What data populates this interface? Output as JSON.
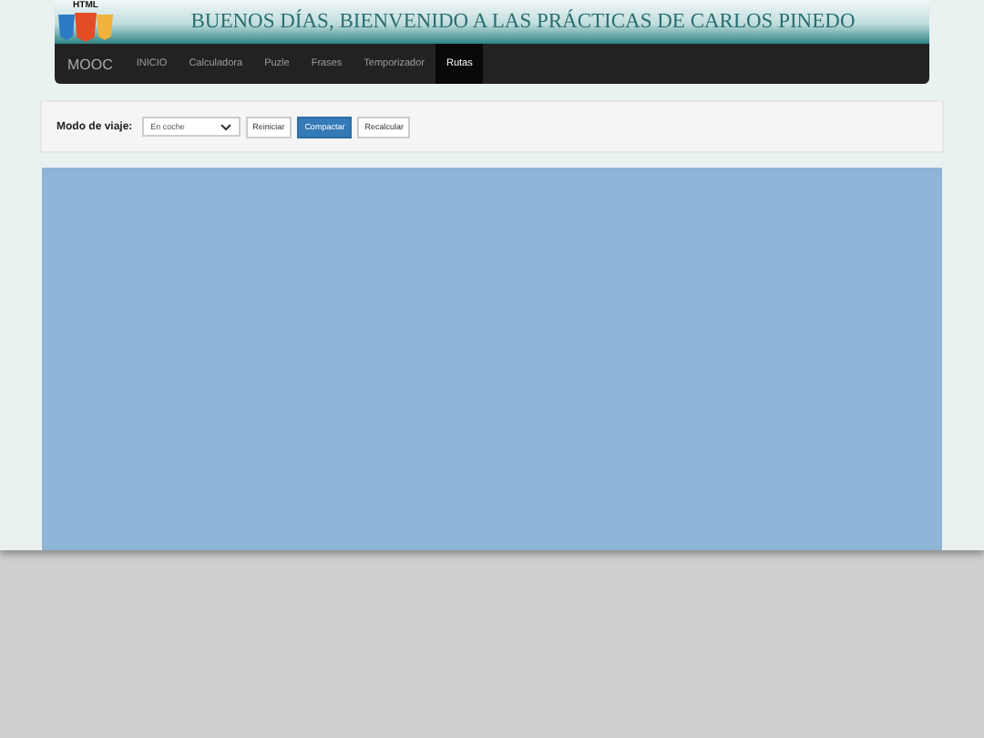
{
  "header": {
    "logo_text": "HTML",
    "title": "BUENOS DÍAS, BIENVENIDO A LAS PRÁCTICAS DE CARLOS PINEDO"
  },
  "navbar": {
    "brand": "MOOC",
    "items": [
      {
        "label": "INICIO",
        "selected": false
      },
      {
        "label": "Calculadora",
        "selected": false
      },
      {
        "label": "Puzle",
        "selected": false
      },
      {
        "label": "Frases",
        "selected": false
      },
      {
        "label": "Temporizador",
        "selected": false
      },
      {
        "label": "Rutas",
        "selected": true
      }
    ]
  },
  "toolbar": {
    "label": "Modo de viaje:",
    "mode": "En coche",
    "buttons": [
      {
        "label": "Reiniciar",
        "selected": false
      },
      {
        "label": "Compactar",
        "selected": true
      },
      {
        "label": "Recalcular",
        "selected": false
      }
    ]
  }
}
